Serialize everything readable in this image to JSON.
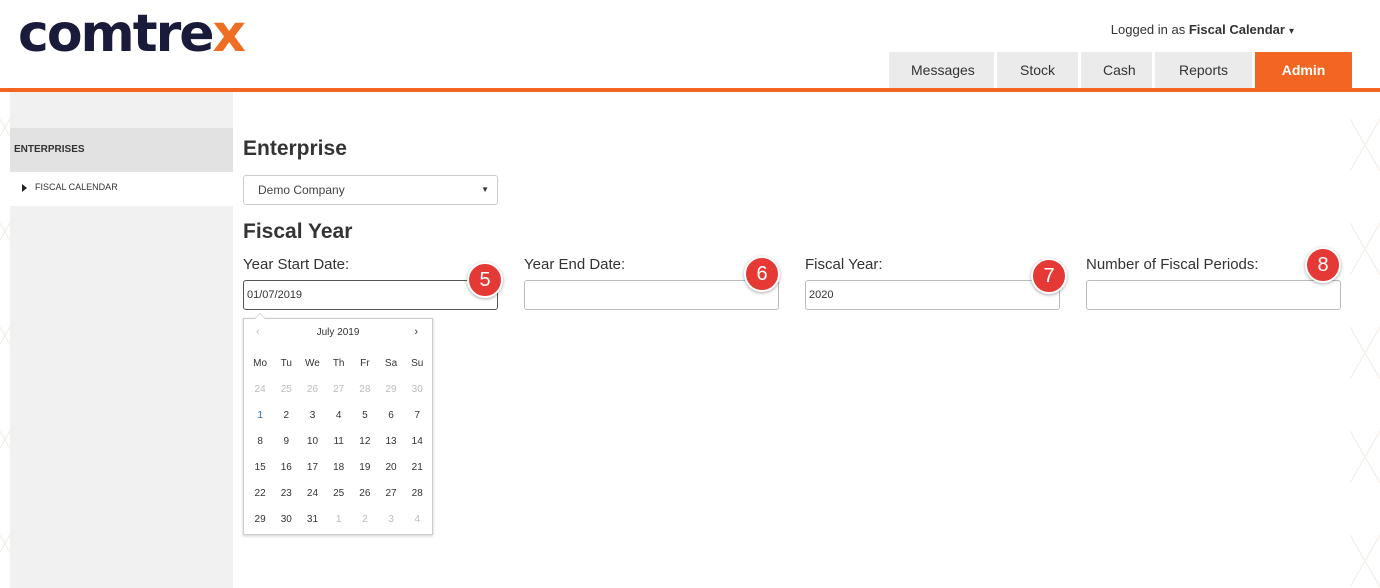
{
  "brand": {
    "logo_main": "comtre",
    "logo_accent": "x",
    "accent_color": "#f26522"
  },
  "header": {
    "logged_prefix": "Logged in as",
    "logged_user": "Fiscal Calendar",
    "nav": [
      {
        "label": "Messages"
      },
      {
        "label": "Stock"
      },
      {
        "label": "Cash"
      },
      {
        "label": "Reports"
      },
      {
        "label": "Admin"
      }
    ]
  },
  "sidebar": {
    "heading": "ENTERPRISES",
    "items": [
      {
        "label": "FISCAL CALENDAR"
      }
    ]
  },
  "main": {
    "enterprise_heading": "Enterprise",
    "enterprise_value": "Demo Company",
    "fiscal_heading": "Fiscal Year",
    "fields": [
      {
        "label": "Year Start Date:",
        "value": "01/07/2019",
        "badge": "5"
      },
      {
        "label": "Year End Date:",
        "value": "",
        "badge": "6"
      },
      {
        "label": "Fiscal Year:",
        "value": "2020",
        "badge": "7"
      },
      {
        "label": "Number of Fiscal Periods:",
        "value": "",
        "badge": "8"
      }
    ]
  },
  "datepicker": {
    "title": "July 2019",
    "prev": "‹",
    "next": "›",
    "weekdays": [
      "Mo",
      "Tu",
      "We",
      "Th",
      "Fr",
      "Sa",
      "Su"
    ],
    "weeks": [
      [
        "24",
        "25",
        "26",
        "27",
        "28",
        "29",
        "30"
      ],
      [
        "1",
        "2",
        "3",
        "4",
        "5",
        "6",
        "7"
      ],
      [
        "8",
        "9",
        "10",
        "11",
        "12",
        "13",
        "14"
      ],
      [
        "15",
        "16",
        "17",
        "18",
        "19",
        "20",
        "21"
      ],
      [
        "22",
        "23",
        "24",
        "25",
        "26",
        "27",
        "28"
      ],
      [
        "29",
        "30",
        "31",
        "1",
        "2",
        "3",
        "4"
      ]
    ],
    "selected": "1"
  }
}
